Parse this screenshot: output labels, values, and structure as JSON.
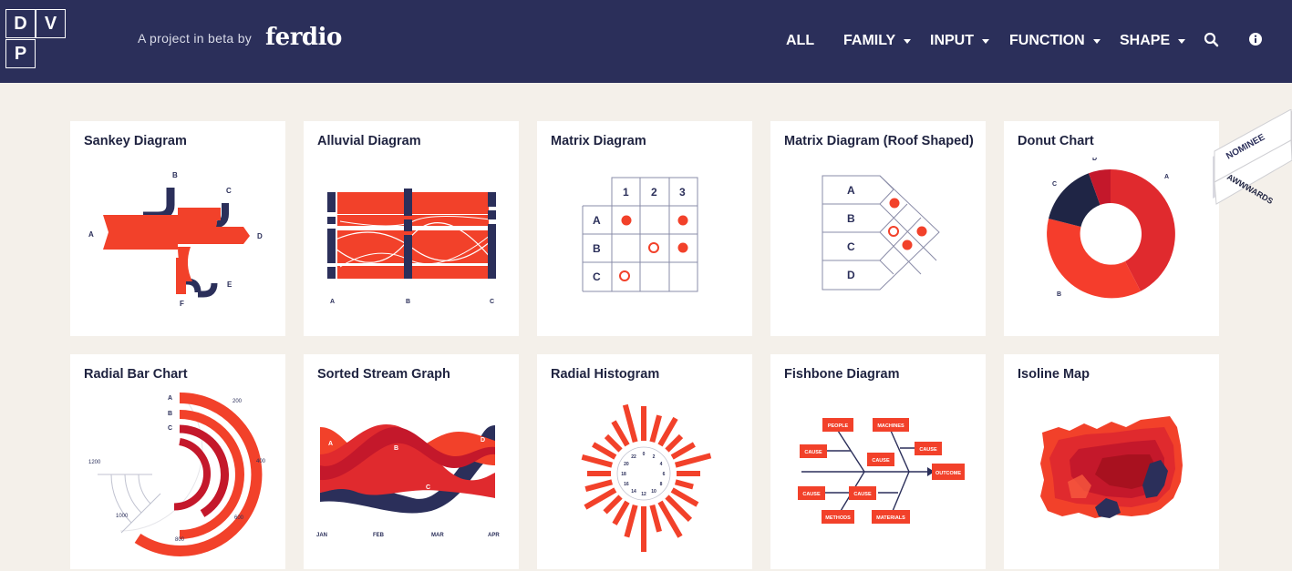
{
  "logo": {
    "letters": [
      "D",
      "V",
      "P"
    ]
  },
  "header": {
    "tagline": "A project in beta by",
    "brand": "ferdio"
  },
  "nav": [
    {
      "label": "ALL"
    },
    {
      "label": "FAMILY"
    },
    {
      "label": "INPUT"
    },
    {
      "label": "FUNCTION"
    },
    {
      "label": "SHAPE"
    }
  ],
  "icons": {
    "search": "search-icon",
    "info": "info-icon"
  },
  "awards": {
    "line1": "NOMINEE",
    "line2": "AWWWARDS"
  },
  "colors": {
    "navy": "#2b2f5a",
    "red": "#f2412a",
    "dark_red": "#c4182b",
    "background": "#f4f0ea"
  },
  "cards": [
    {
      "title": "Sankey Diagram",
      "labels": [
        "A",
        "B",
        "C",
        "D",
        "E",
        "F"
      ]
    },
    {
      "title": "Alluvial Diagram",
      "labels": [
        "A",
        "B",
        "C"
      ]
    },
    {
      "title": "Matrix Diagram",
      "cols": [
        "1",
        "2",
        "3"
      ],
      "rows": [
        "A",
        "B",
        "C"
      ]
    },
    {
      "title": "Matrix Diagram (Roof Shaped)",
      "rows": [
        "A",
        "B",
        "C",
        "D"
      ]
    },
    {
      "title": "Donut Chart",
      "labels": [
        "A",
        "B",
        "C",
        "D"
      ]
    },
    {
      "title": "Radial Bar Chart",
      "labels": [
        "A",
        "B",
        "C"
      ],
      "ticks": [
        "200",
        "400",
        "600",
        "800",
        "1000",
        "1200"
      ]
    },
    {
      "title": "Sorted Stream Graph",
      "labels": [
        "A",
        "B",
        "C",
        "D"
      ],
      "months": [
        "JAN",
        "FEB",
        "MAR",
        "APR"
      ]
    },
    {
      "title": "Radial Histogram",
      "ticks": [
        "0",
        "2",
        "4",
        "6",
        "8",
        "10",
        "12",
        "14",
        "16",
        "18",
        "20",
        "22"
      ]
    },
    {
      "title": "Fishbone Diagram",
      "boxes": [
        "PEOPLE",
        "MACHINES",
        "CAUSE",
        "CAUSE",
        "CAUSE",
        "CAUSE",
        "CAUSE",
        "METHODS",
        "MATERIALS"
      ],
      "outcome": "OUTCOME"
    },
    {
      "title": "Isoline Map"
    }
  ]
}
